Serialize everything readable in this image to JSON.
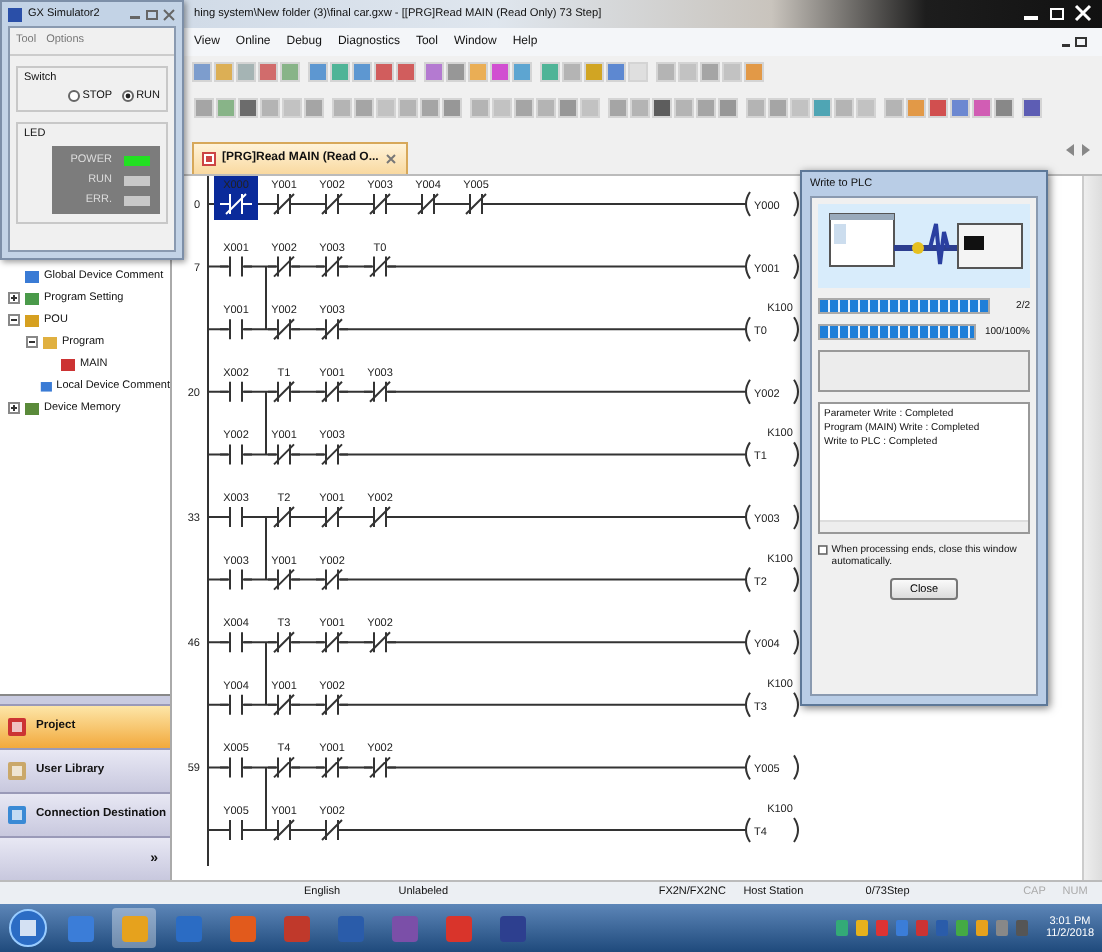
{
  "window": {
    "title": "hing system\\New folder (3)\\final car.gxw - [[PRG]Read MAIN (Read Only) 73 Step]"
  },
  "simulator": {
    "title": "GX Simulator2",
    "menu": [
      "Tool",
      "Options"
    ],
    "switch": {
      "label": "Switch",
      "options": [
        {
          "label": "STOP",
          "selected": false
        },
        {
          "label": "RUN",
          "selected": true
        }
      ]
    },
    "led": {
      "label": "LED",
      "lamps": [
        {
          "label": "POWER",
          "on": true
        },
        {
          "label": "RUN",
          "on": false
        },
        {
          "label": "ERR.",
          "on": false
        }
      ]
    }
  },
  "menu": [
    "View",
    "Online",
    "Debug",
    "Diagnostics",
    "Tool",
    "Window",
    "Help"
  ],
  "tab": {
    "label": "[PRG]Read MAIN (Read O..."
  },
  "tree": [
    {
      "label": "Global Device Comment",
      "kind": "comment"
    },
    {
      "label": "Program Setting",
      "kind": "setting",
      "expanded": false
    },
    {
      "label": "POU",
      "kind": "pou",
      "expanded": true,
      "children": [
        {
          "label": "Program",
          "kind": "folder",
          "expanded": true,
          "children": [
            {
              "label": "MAIN",
              "kind": "program"
            }
          ]
        },
        {
          "label": "Local Device Comment",
          "kind": "comment"
        }
      ]
    },
    {
      "label": "Device Memory",
      "kind": "memory",
      "expanded": false
    }
  ],
  "nav": [
    {
      "label": "Project",
      "selected": true
    },
    {
      "label": "User Library",
      "selected": false
    },
    {
      "label": "Connection Destination",
      "selected": false
    }
  ],
  "nav_more": "»",
  "rungs": [
    {
      "step": "0",
      "rows": [
        {
          "contacts": [
            {
              "label": "X000",
              "kind": "nc",
              "selected": true
            },
            {
              "label": "Y001",
              "kind": "nc",
              "selected": false
            },
            {
              "label": "Y002",
              "kind": "nc",
              "selected": false
            },
            {
              "label": "Y003",
              "kind": "nc",
              "selected": false
            },
            {
              "label": "Y004",
              "kind": "nc",
              "selected": false
            },
            {
              "label": "Y005",
              "kind": "nc",
              "selected": false
            }
          ],
          "coil": "Y000"
        }
      ]
    },
    {
      "step": "7",
      "rows": [
        {
          "contacts": [
            {
              "label": "X001",
              "kind": "no",
              "selected": false
            },
            {
              "label": "Y002",
              "kind": "nc",
              "selected": false
            },
            {
              "label": "Y003",
              "kind": "nc",
              "selected": false
            },
            {
              "label": "T0",
              "kind": "nc",
              "selected": false
            }
          ],
          "coil": "Y001"
        },
        {
          "contacts": [
            {
              "label": "Y001",
              "kind": "no",
              "selected": false
            },
            {
              "label": "Y002",
              "kind": "nc",
              "selected": false
            },
            {
              "label": "Y003",
              "kind": "nc",
              "selected": false
            }
          ],
          "coil": "T0",
          "preset": "K100"
        }
      ]
    },
    {
      "step": "20",
      "rows": [
        {
          "contacts": [
            {
              "label": "X002",
              "kind": "no",
              "selected": false
            },
            {
              "label": "T1",
              "kind": "nc",
              "selected": false
            },
            {
              "label": "Y001",
              "kind": "nc",
              "selected": false
            },
            {
              "label": "Y003",
              "kind": "nc",
              "selected": false
            }
          ],
          "coil": "Y002"
        },
        {
          "contacts": [
            {
              "label": "Y002",
              "kind": "no",
              "selected": false
            },
            {
              "label": "Y001",
              "kind": "nc",
              "selected": false
            },
            {
              "label": "Y003",
              "kind": "nc",
              "selected": false
            }
          ],
          "coil": "T1",
          "preset": "K100"
        }
      ]
    },
    {
      "step": "33",
      "rows": [
        {
          "contacts": [
            {
              "label": "X003",
              "kind": "no",
              "selected": false
            },
            {
              "label": "T2",
              "kind": "nc",
              "selected": false
            },
            {
              "label": "Y001",
              "kind": "nc",
              "selected": false
            },
            {
              "label": "Y002",
              "kind": "nc",
              "selected": false
            }
          ],
          "coil": "Y003"
        },
        {
          "contacts": [
            {
              "label": "Y003",
              "kind": "no",
              "selected": false
            },
            {
              "label": "Y001",
              "kind": "nc",
              "selected": false
            },
            {
              "label": "Y002",
              "kind": "nc",
              "selected": false
            }
          ],
          "coil": "T2",
          "preset": "K100"
        }
      ]
    },
    {
      "step": "46",
      "rows": [
        {
          "contacts": [
            {
              "label": "X004",
              "kind": "no",
              "selected": false
            },
            {
              "label": "T3",
              "kind": "nc",
              "selected": false
            },
            {
              "label": "Y001",
              "kind": "nc",
              "selected": false
            },
            {
              "label": "Y002",
              "kind": "nc",
              "selected": false
            }
          ],
          "coil": "Y004"
        },
        {
          "contacts": [
            {
              "label": "Y004",
              "kind": "no",
              "selected": false
            },
            {
              "label": "Y001",
              "kind": "nc",
              "selected": false
            },
            {
              "label": "Y002",
              "kind": "nc",
              "selected": false
            }
          ],
          "coil": "T3",
          "preset": "K100"
        }
      ]
    },
    {
      "step": "59",
      "rows": [
        {
          "contacts": [
            {
              "label": "X005",
              "kind": "no",
              "selected": false
            },
            {
              "label": "T4",
              "kind": "nc",
              "selected": false
            },
            {
              "label": "Y001",
              "kind": "nc",
              "selected": false
            },
            {
              "label": "Y002",
              "kind": "nc",
              "selected": false
            }
          ],
          "coil": "Y005"
        },
        {
          "contacts": [
            {
              "label": "Y005",
              "kind": "no",
              "selected": false
            },
            {
              "label": "Y001",
              "kind": "nc",
              "selected": false
            },
            {
              "label": "Y002",
              "kind": "nc",
              "selected": false
            }
          ],
          "coil": "T4",
          "preset": "K100"
        }
      ]
    }
  ],
  "dialog": {
    "title": "Write to PLC",
    "progress": [
      {
        "level": 1,
        "reading": "2/2"
      },
      {
        "level": 1,
        "reading": "100/100%"
      }
    ],
    "log": [
      "Parameter Write : Completed",
      "Program (MAIN) Write : Completed",
      "Write to PLC : Completed"
    ],
    "auto_close": {
      "label": "When processing ends, close this window automatically.",
      "checked": false
    },
    "button": "Close"
  },
  "status_bar": [
    {
      "text": "English",
      "disabled": false
    },
    {
      "text": "Unlabeled",
      "disabled": false
    },
    {
      "text": "FX2N/FX2NC",
      "disabled": false
    },
    {
      "text": "Host Station",
      "disabled": false
    },
    {
      "text": "0/73Step",
      "disabled": false
    },
    {
      "text": "CAP",
      "disabled": true
    },
    {
      "text": "NUM",
      "disabled": true
    }
  ],
  "taskbar": {
    "time": "3:01 PM",
    "date": "11/2/2018"
  }
}
